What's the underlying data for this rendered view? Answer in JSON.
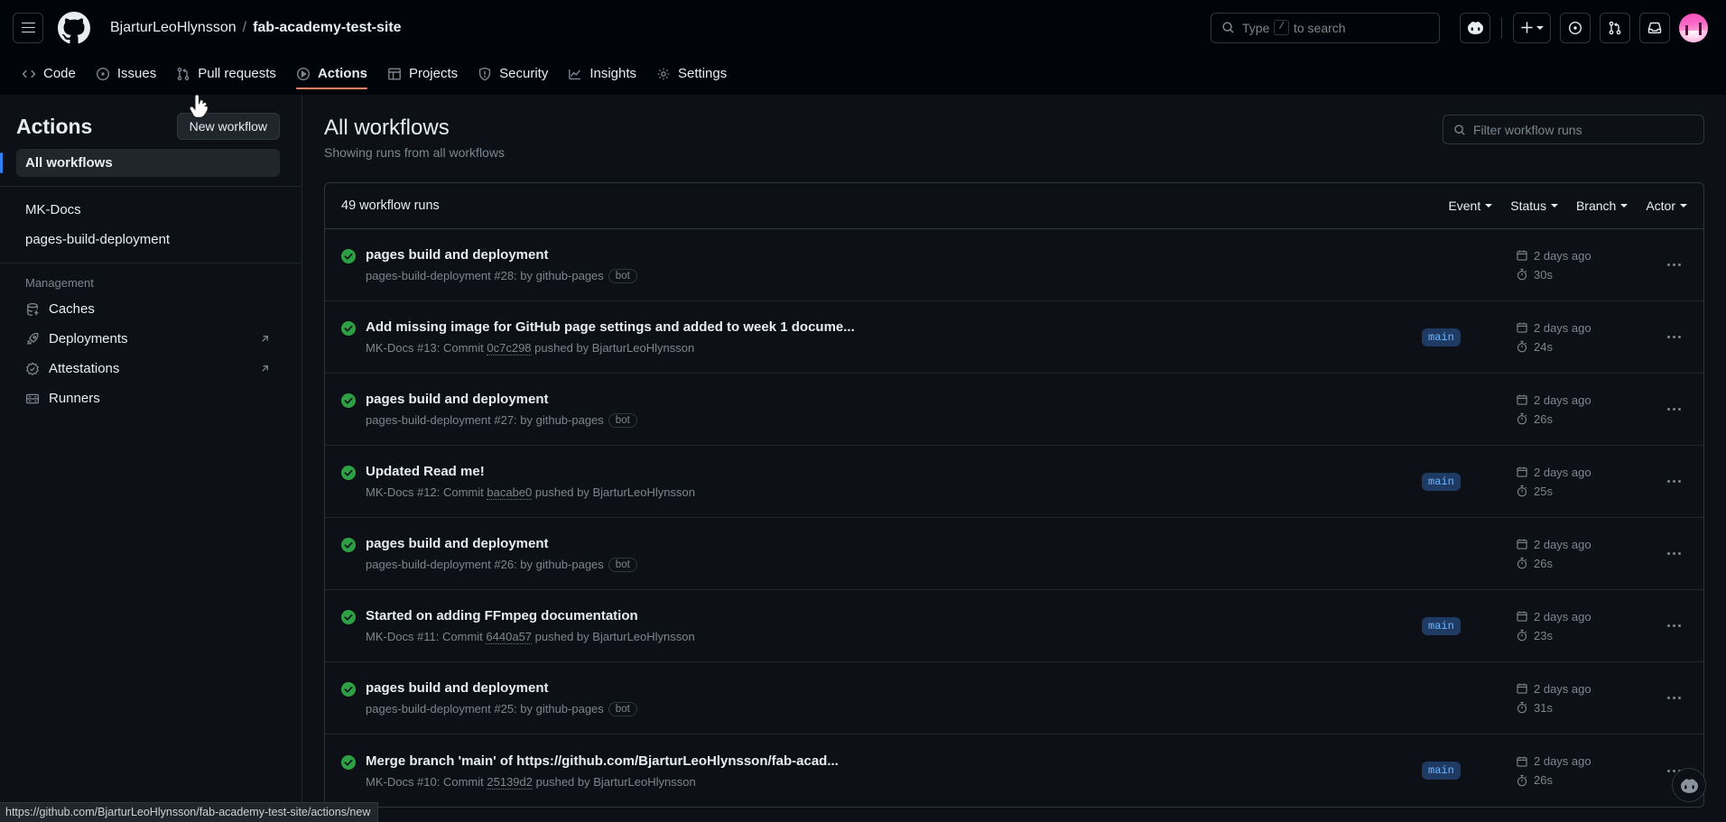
{
  "header": {
    "hamburger": "menu-icon",
    "logo": "github-logo",
    "owner": "BjarturLeoHlynsson",
    "separator": "/",
    "repo": "fab-academy-test-site",
    "search_placeholder_pre": "Type",
    "search_key": "/",
    "search_placeholder_post": "to search",
    "icons": [
      "copilot-icon",
      "plus-icon",
      "issues-icon",
      "pull-requests-icon",
      "inbox-icon",
      "avatar"
    ]
  },
  "nav": {
    "tabs": [
      {
        "label": "Code",
        "icon": "code-icon",
        "active": false
      },
      {
        "label": "Issues",
        "icon": "issue-opened-icon",
        "active": false
      },
      {
        "label": "Pull requests",
        "icon": "git-pull-request-icon",
        "active": false
      },
      {
        "label": "Actions",
        "icon": "play-icon",
        "active": true
      },
      {
        "label": "Projects",
        "icon": "table-icon",
        "active": false
      },
      {
        "label": "Security",
        "icon": "shield-icon",
        "active": false
      },
      {
        "label": "Insights",
        "icon": "graph-icon",
        "active": false
      },
      {
        "label": "Settings",
        "icon": "gear-icon",
        "active": false
      }
    ]
  },
  "sidebar": {
    "title": "Actions",
    "new_workflow_label": "New workflow",
    "all_workflows": "All workflows",
    "workflows": [
      {
        "label": "MK-Docs"
      },
      {
        "label": "pages-build-deployment"
      }
    ],
    "management_label": "Management",
    "management": [
      {
        "label": "Caches",
        "icon": "cache-icon",
        "external": false
      },
      {
        "label": "Deployments",
        "icon": "rocket-icon",
        "external": true
      },
      {
        "label": "Attestations",
        "icon": "verified-icon",
        "external": true
      },
      {
        "label": "Runners",
        "icon": "server-icon",
        "external": false
      }
    ]
  },
  "main": {
    "title": "All workflows",
    "subtitle": "Showing runs from all workflows",
    "filter_placeholder": "Filter workflow runs",
    "runs_count": "49 workflow runs",
    "filters": [
      {
        "label": "Event"
      },
      {
        "label": "Status"
      },
      {
        "label": "Branch"
      },
      {
        "label": "Actor"
      }
    ],
    "runs": [
      {
        "status": "success",
        "title": "pages build and deployment",
        "meta_prefix": "pages-build-deployment #28: by github-pages",
        "commit": "",
        "meta_suffix": "",
        "bot": "bot",
        "branch": "",
        "age": "2 days ago",
        "duration": "30s"
      },
      {
        "status": "success",
        "title": "Add missing image for GitHub page settings and added to week 1 docume...",
        "meta_prefix": "MK-Docs #13: Commit",
        "commit": "0c7c298",
        "meta_suffix": "pushed by BjarturLeoHlynsson",
        "bot": "",
        "branch": "main",
        "age": "2 days ago",
        "duration": "24s"
      },
      {
        "status": "success",
        "title": "pages build and deployment",
        "meta_prefix": "pages-build-deployment #27: by github-pages",
        "commit": "",
        "meta_suffix": "",
        "bot": "bot",
        "branch": "",
        "age": "2 days ago",
        "duration": "26s"
      },
      {
        "status": "success",
        "title": "Updated Read me!",
        "meta_prefix": "MK-Docs #12: Commit",
        "commit": "bacabe0",
        "meta_suffix": "pushed by BjarturLeoHlynsson",
        "bot": "",
        "branch": "main",
        "age": "2 days ago",
        "duration": "25s"
      },
      {
        "status": "success",
        "title": "pages build and deployment",
        "meta_prefix": "pages-build-deployment #26: by github-pages",
        "commit": "",
        "meta_suffix": "",
        "bot": "bot",
        "branch": "",
        "age": "2 days ago",
        "duration": "26s"
      },
      {
        "status": "success",
        "title": "Started on adding FFmpeg documentation",
        "meta_prefix": "MK-Docs #11: Commit",
        "commit": "6440a57",
        "meta_suffix": "pushed by BjarturLeoHlynsson",
        "bot": "",
        "branch": "main",
        "age": "2 days ago",
        "duration": "23s"
      },
      {
        "status": "success",
        "title": "pages build and deployment",
        "meta_prefix": "pages-build-deployment #25: by github-pages",
        "commit": "",
        "meta_suffix": "",
        "bot": "bot",
        "branch": "",
        "age": "2 days ago",
        "duration": "31s"
      },
      {
        "status": "success",
        "title": "Merge branch 'main' of https://github.com/BjarturLeoHlynsson/fab-acad...",
        "meta_prefix": "MK-Docs #10: Commit",
        "commit": "25139d2",
        "meta_suffix": "pushed by BjarturLeoHlynsson",
        "bot": "",
        "branch": "main",
        "age": "2 days ago",
        "duration": "26s"
      }
    ]
  },
  "statusbar": {
    "url": "https://github.com/BjarturLeoHlynsson/fab-academy-test-site/actions/new"
  },
  "floating": {
    "copilot": "copilot-icon"
  },
  "colors": {
    "accent_underline": "#f78166",
    "success_green": "#2ea043",
    "branch_badge_bg": "#1f3b63",
    "branch_badge_fg": "#6cb6ff",
    "selected_bar": "#2f81f7",
    "bg": "#0d1117",
    "header_bg": "#010409"
  }
}
